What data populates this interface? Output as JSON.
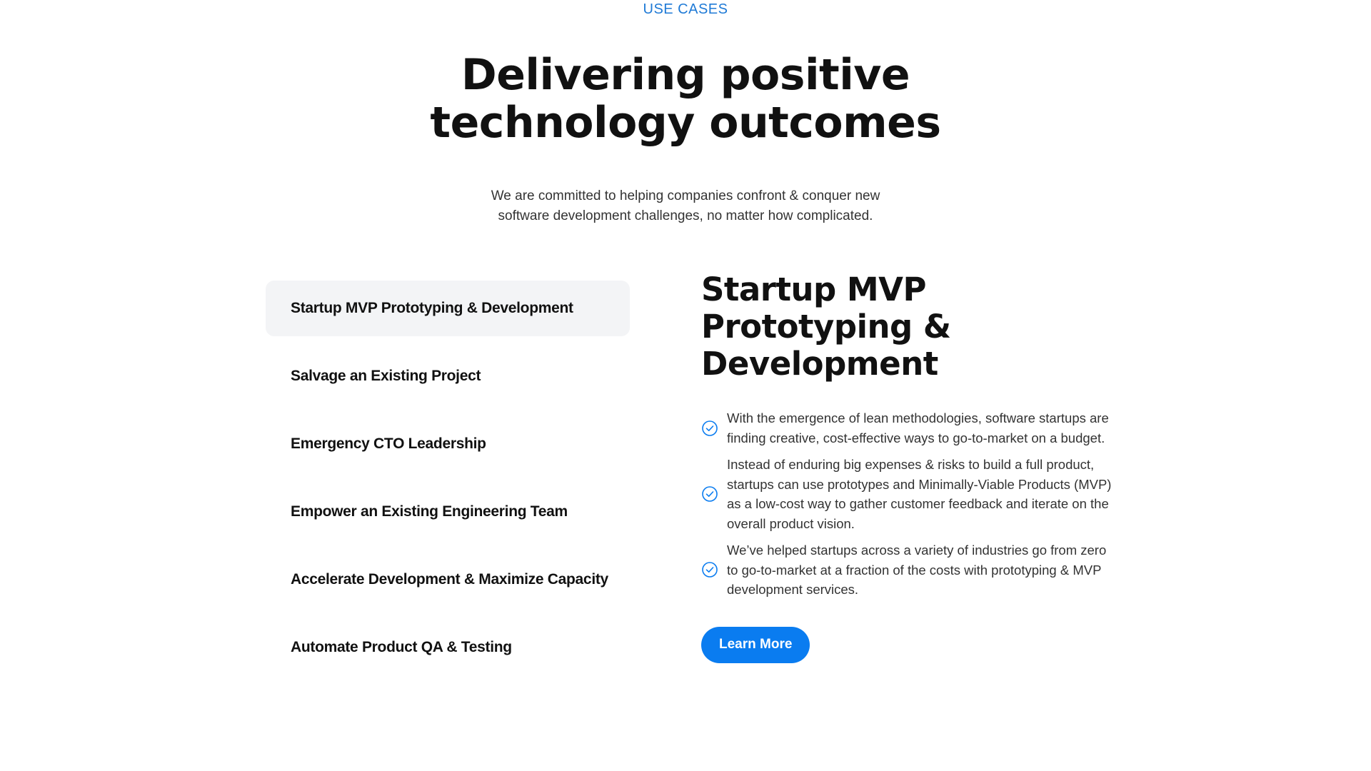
{
  "section": {
    "eyebrow": "USE CASES",
    "headline_line1": "Delivering positive",
    "headline_line2": "technology outcomes",
    "subtitle_line1": "We are committed to helping companies confront & conquer new",
    "subtitle_line2": "software development challenges, no matter how complicated."
  },
  "tabs": [
    {
      "label": "Startup MVP Prototyping & Development",
      "active": true
    },
    {
      "label": "Salvage an Existing Project",
      "active": false
    },
    {
      "label": "Emergency CTO Leadership",
      "active": false
    },
    {
      "label": "Empower an Existing Engineering Team",
      "active": false
    },
    {
      "label": "Accelerate Development & Maximize Capacity",
      "active": false
    },
    {
      "label": "Automate Product QA & Testing",
      "active": false
    }
  ],
  "detail": {
    "title_line1": "Startup MVP",
    "title_line2": "Prototyping &",
    "title_line3": "Development",
    "points": [
      {
        "icon": "check-circle-icon",
        "text": "With the emergence of lean methodologies, software startups are finding creative, cost-effective ways to go-to-market on a budget."
      },
      {
        "icon": "check-circle-icon",
        "text": "Instead of enduring big expenses & risks to build a full product, startups can use prototypes and Minimally-Viable Products (MVP) as a low-cost way to gather customer feedback and iterate on the overall product vision."
      },
      {
        "icon": "check-circle-icon",
        "text": "We’ve helped startups across a variety of industries go from zero to go-to-market at a fraction of the costs with prototyping & MVP development services."
      }
    ],
    "cta_label": "Learn More"
  },
  "colors": {
    "accent": "#0a7cf0",
    "eyebrow": "#1f7ad6",
    "active_tab_bg": "#f3f4f6",
    "heading": "#111111",
    "body_text": "#333333"
  }
}
